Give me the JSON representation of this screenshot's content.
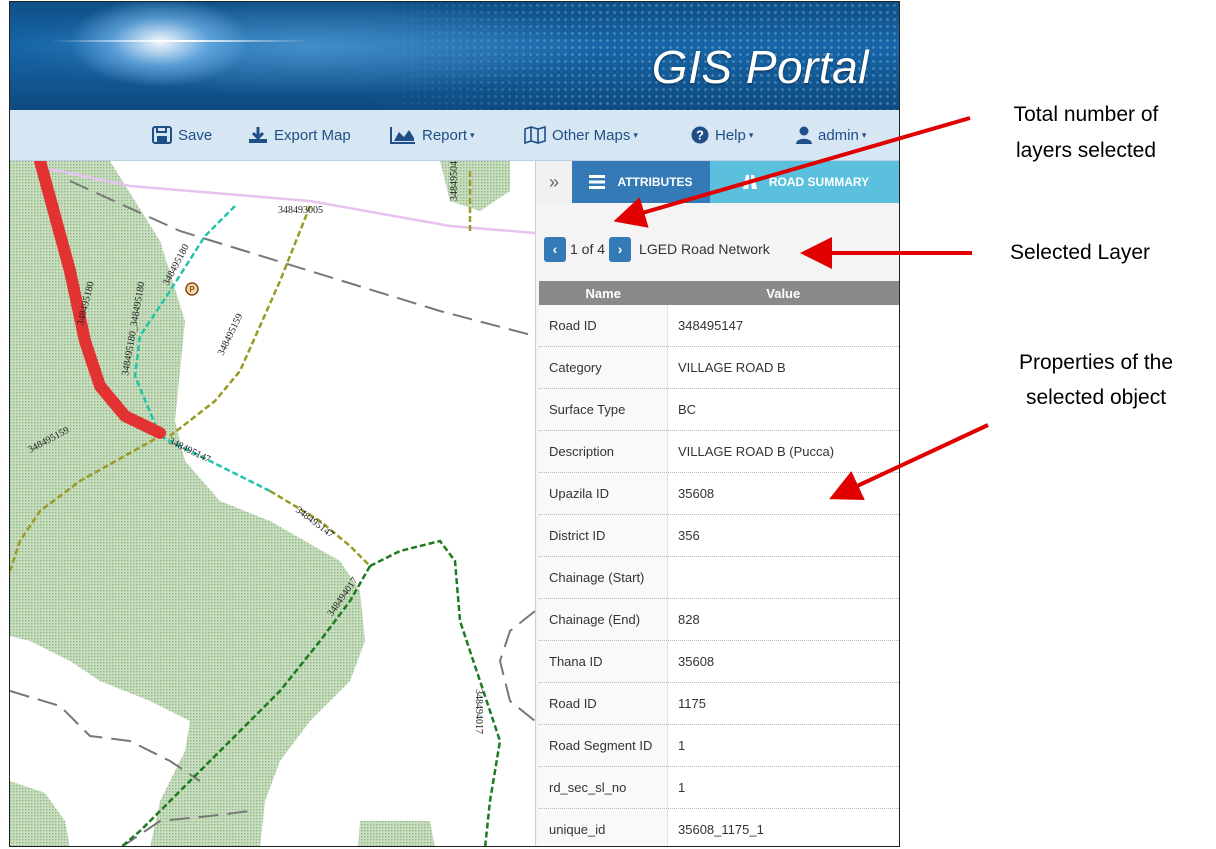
{
  "header": {
    "title": "GIS Portal"
  },
  "menu": {
    "save": "Save",
    "export": "Export Map",
    "report": "Report",
    "other_maps": "Other Maps",
    "help": "Help",
    "user": "admin"
  },
  "panel": {
    "collapse_glyph": "»",
    "tabs": {
      "attributes": "ATTRIBUTES",
      "road_summary": "ROAD SUMMARY"
    },
    "pager": {
      "prev": "‹",
      "next": "›",
      "count": "1 of 4",
      "layer": "LGED Road Network"
    },
    "table": {
      "headers": [
        "Name",
        "Value"
      ],
      "rows": [
        [
          "Road ID",
          "348495147"
        ],
        [
          "Category",
          "VILLAGE ROAD B"
        ],
        [
          "Surface Type",
          "BC"
        ],
        [
          "Description",
          "VILLAGE ROAD B (Pucca)"
        ],
        [
          "Upazila ID",
          "35608"
        ],
        [
          "District ID",
          "356"
        ],
        [
          "Chainage (Start)",
          ""
        ],
        [
          "Chainage (End)",
          "828"
        ],
        [
          "Thana ID",
          "35608"
        ],
        [
          "Road ID",
          "1175"
        ],
        [
          "Road Segment ID",
          "1"
        ],
        [
          "rd_sec_sl_no",
          "1"
        ],
        [
          "unique_id",
          "35608_1175_1"
        ]
      ]
    }
  },
  "map_labels": {
    "l1": "348493005",
    "l2": "348495043",
    "l3": "348495180",
    "l4": "348495180",
    "l5": "348495159",
    "l6": "348495147",
    "l7": "348495159",
    "l8": "348495147",
    "l9": "348494017",
    "l10": "348494017",
    "l11": "348495180_348495180",
    "l12": "348495180"
  },
  "annotations": {
    "total_layers_1": "Total number of",
    "total_layers_2": "layers selected",
    "selected_layer": "Selected Layer",
    "properties_1": "Properties of the",
    "properties_2": "selected object"
  },
  "colors": {
    "primary": "#337ab7",
    "tab_secondary": "#5bc0de",
    "menu_text": "#1f4f87",
    "menubar": "#d6e6f3",
    "highlight_road": "#e23232",
    "arrow": "#e00000"
  }
}
